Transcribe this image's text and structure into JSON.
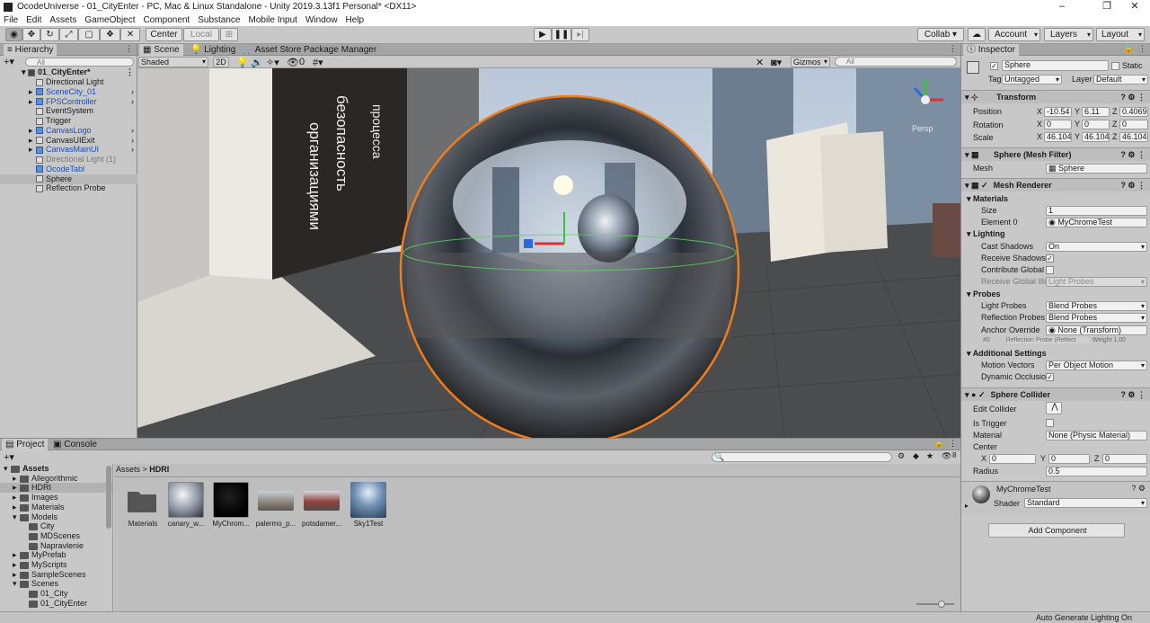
{
  "window": {
    "title": "OcodeUniverse - 01_CityEnter - PC, Mac & Linux Standalone - Unity 2019.3.13f1 Personal* <DX11>",
    "controls": [
      "–",
      "❐",
      "✕"
    ]
  },
  "menu": [
    "File",
    "Edit",
    "Assets",
    "GameObject",
    "Component",
    "Substance",
    "Mobile Input",
    "Window",
    "Help"
  ],
  "toolbar": {
    "center": "Center",
    "local": "Local",
    "collab": "Collab ▾",
    "account": "Account",
    "layers": "Layers",
    "layout": "Layout"
  },
  "hierarchy": {
    "tab": "Hierarchy",
    "search_placeholder": "All",
    "scene": "01_CityEnter*",
    "items": [
      {
        "label": "Directional Light",
        "prefab": false,
        "arrow": false,
        "dim": false
      },
      {
        "label": "SceneCity_01",
        "prefab": true,
        "arrow": true,
        "dim": false
      },
      {
        "label": "FPSController",
        "prefab": true,
        "arrow": true,
        "dim": false
      },
      {
        "label": "EventSystem",
        "prefab": false,
        "arrow": false,
        "dim": false
      },
      {
        "label": "Trigger",
        "prefab": false,
        "arrow": false,
        "dim": false
      },
      {
        "label": "CanvasLogo",
        "prefab": true,
        "arrow": true,
        "dim": false
      },
      {
        "label": "CanvasUIExit",
        "prefab": false,
        "arrow": true,
        "dim": false
      },
      {
        "label": "CanvasMainUI",
        "prefab": true,
        "arrow": true,
        "dim": false
      },
      {
        "label": "Directional Light (1)",
        "prefab": false,
        "arrow": false,
        "dim": true
      },
      {
        "label": "OcodeTabl",
        "prefab": true,
        "arrow": false,
        "dim": false
      },
      {
        "label": "Sphere",
        "prefab": false,
        "arrow": false,
        "dim": false,
        "selected": true
      },
      {
        "label": "Reflection Probe",
        "prefab": false,
        "arrow": false,
        "dim": false
      }
    ]
  },
  "scene_tabs": [
    "Scene",
    "Lighting",
    "Asset Store",
    "Package Manager"
  ],
  "scene_toolbar": {
    "shading": "Shaded",
    "mode_2d": "2D",
    "fx_count": "0",
    "gizmos": "Gizmos",
    "search_placeholder": "All",
    "persp": "Persp"
  },
  "billboard_text": [
    "организациями",
    "безопасность",
    "процесса"
  ],
  "project": {
    "tabs": [
      "Project",
      "Console"
    ],
    "count": "8",
    "tree": [
      {
        "label": "Assets",
        "level": 0,
        "bold": true
      },
      {
        "label": "Allegorithmic",
        "level": 1
      },
      {
        "label": "HDRI",
        "level": 1,
        "selected": true
      },
      {
        "label": "Images",
        "level": 1
      },
      {
        "label": "Materials",
        "level": 1
      },
      {
        "label": "Models",
        "level": 1
      },
      {
        "label": "City",
        "level": 2
      },
      {
        "label": "MDScenes",
        "level": 2
      },
      {
        "label": "Napravlenie",
        "level": 2
      },
      {
        "label": "MyPrefab",
        "level": 1
      },
      {
        "label": "MyScripts",
        "level": 1
      },
      {
        "label": "SampleScenes",
        "level": 1
      },
      {
        "label": "Scenes",
        "level": 1
      },
      {
        "label": "01_City",
        "level": 2
      },
      {
        "label": "01_CityEnter",
        "level": 2
      }
    ],
    "breadcrumb": [
      "Assets",
      "HDRI"
    ],
    "assets": [
      "Materials",
      "canary_w...",
      "MyChrom...",
      "palermo_p...",
      "potsdamer...",
      "Sky1Test"
    ]
  },
  "inspector": {
    "tab": "Inspector",
    "object_name": "Sphere",
    "static_label": "Static",
    "tag_label": "Tag",
    "tag_value": "Untagged",
    "layer_label": "Layer",
    "layer_value": "Default",
    "transform": {
      "title": "Transform",
      "position_label": "Position",
      "rotation_label": "Rotation",
      "scale_label": "Scale",
      "position": [
        "-10.54",
        "6.11",
        "0.4069"
      ],
      "rotation": [
        "0",
        "0",
        "0"
      ],
      "scale": [
        "46.1046",
        "46.1046",
        "46.1046"
      ]
    },
    "mesh_filter": {
      "title": "Sphere (Mesh Filter)",
      "mesh_label": "Mesh",
      "mesh_value": "Sphere"
    },
    "mesh_renderer": {
      "title": "Mesh Renderer",
      "materials": "Materials",
      "size_label": "Size",
      "size_value": "1",
      "element_label": "Element 0",
      "element_value": "MyChromeTest",
      "lighting": "Lighting",
      "cast_label": "Cast Shadows",
      "cast_value": "On",
      "receive_label": "Receive Shadows",
      "contrib_label": "Contribute Global I",
      "recgi_label": "Receive Global Illu",
      "recgi_value": "Light Probes",
      "probes": "Probes",
      "lp_label": "Light Probes",
      "lp_value": "Blend Probes",
      "rp_label": "Reflection Probes",
      "rp_value": "Blend Probes",
      "anchor_label": "Anchor Override",
      "anchor_value": "None (Transform)",
      "probe_index": "#0",
      "probe_ref": "Reflection Probe (Reflect",
      "probe_weight": "Weight 1.00",
      "additional": "Additional Settings",
      "mv_label": "Motion Vectors",
      "mv_value": "Per Object Motion",
      "dyn_label": "Dynamic Occlusio"
    },
    "collider": {
      "title": "Sphere Collider",
      "edit_label": "Edit Collider",
      "trigger_label": "Is Trigger",
      "material_label": "Material",
      "material_value": "None (Physic Material)",
      "center_label": "Center",
      "center": [
        "0",
        "0",
        "0"
      ],
      "radius_label": "Radius",
      "radius_value": "0.5"
    },
    "material": {
      "name": "MyChromeTest",
      "shader_label": "Shader",
      "shader_value": "Standard"
    },
    "add_component": "Add Component"
  },
  "status": "Auto Generate Lighting On"
}
